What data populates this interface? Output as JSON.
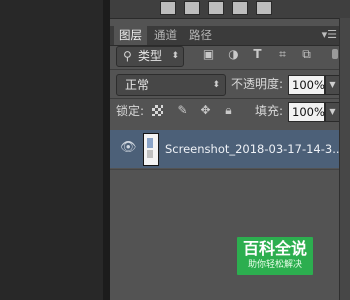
{
  "tabs": [
    {
      "label": "图层",
      "active": true
    },
    {
      "label": "通道",
      "active": false
    },
    {
      "label": "路径",
      "active": false
    }
  ],
  "panel_menu_icon": "panel-menu-icon",
  "filter": {
    "kind_label": "类型",
    "icons": [
      "image-filter-icon",
      "adjustment-filter-icon",
      "type-filter-icon",
      "shape-filter-icon",
      "smart-object-filter-icon"
    ]
  },
  "blend": {
    "mode": "正常",
    "opacity_label": "不透明度:",
    "opacity_value": "100%"
  },
  "lock": {
    "label": "锁定:",
    "fill_label": "填充:",
    "fill_value": "100%"
  },
  "layers": [
    {
      "name": "Screenshot_2018-03-17-14-3...",
      "visible": true,
      "selected": true
    }
  ],
  "watermark": {
    "title": "百科全说",
    "subtitle": "助你轻松解决"
  },
  "colors": {
    "panel": "#535353",
    "selected_layer": "#4c6078",
    "watermark": "#2cae4f"
  }
}
